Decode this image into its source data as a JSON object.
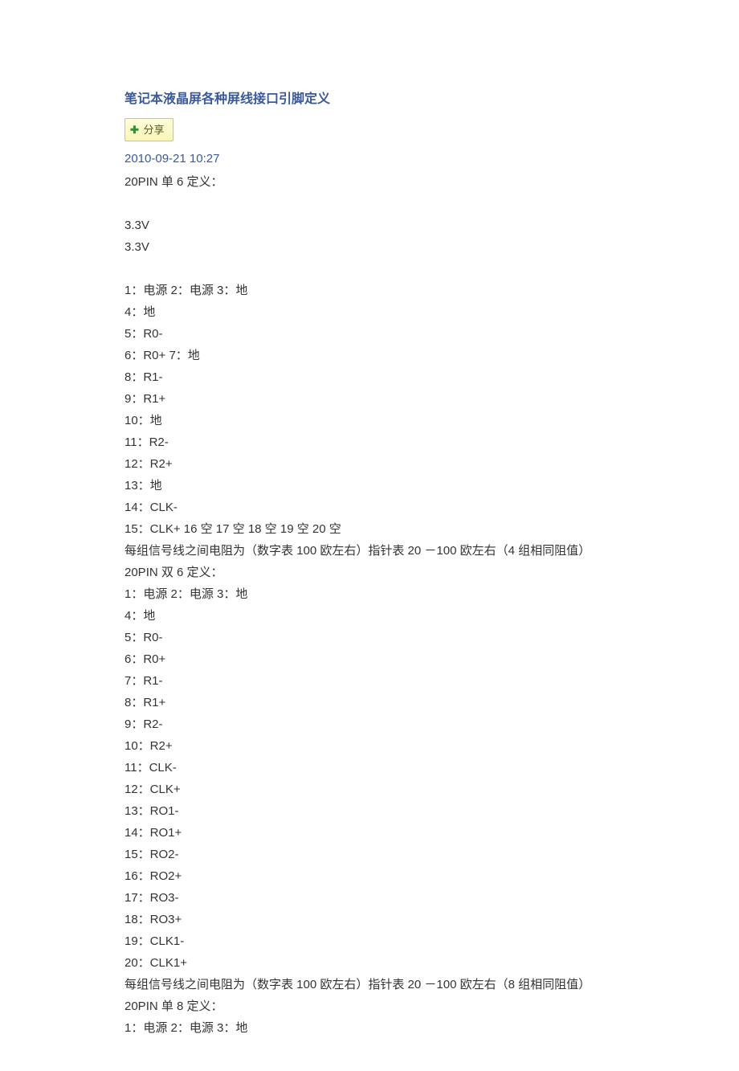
{
  "title": "笔记本液晶屏各种屏线接口引脚定义",
  "share_label": "分享",
  "timestamp": "2010-09-21 10:27",
  "lines": [
    "20PIN 单 6 定义：",
    "",
    "3.3V",
    "3.3V",
    "",
    "1：电源 2：电源 3：地",
    "4：地",
    "5：R0-",
    "6：R0+ 7：地",
    "8：R1-",
    "9：R1+",
    "10：地",
    "11：R2-",
    "12：R2+",
    "13：地",
    "14：CLK-",
    "15：CLK+ 16 空  17 空  18 空  19  空 20 空",
    "每组信号线之间电阻为（数字表 100 欧左右）指针表 20 －100 欧左右（4 组相同阻值）",
    "20PIN 双 6 定义：",
    "1：电源 2：电源 3：地",
    "4：地",
    "5：R0-",
    "6：R0+",
    "7：R1-",
    "8：R1+",
    "9：R2-",
    "10：R2+",
    "11：CLK-",
    "12：CLK+",
    "13：RO1-",
    "14：RO1+",
    "15：RO2-",
    "16：RO2+",
    "17：RO3-",
    "18：RO3+",
    "19：CLK1-",
    "20：CLK1+",
    "每组信号线之间电阻为（数字表 100 欧左右）指针表 20 －100 欧左右（8 组相同阻值）",
    "20PIN 单 8 定义：",
    "1：电源 2：电源 3：地"
  ]
}
